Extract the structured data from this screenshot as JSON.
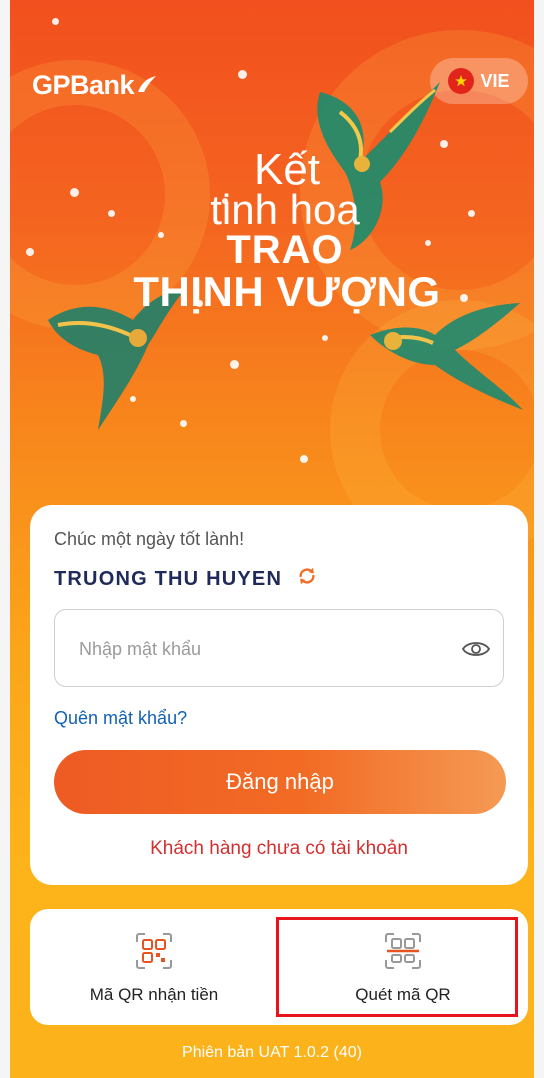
{
  "header": {
    "logo_text": "GPBank",
    "language": {
      "code": "VIE",
      "flag_icon": "vietnam-flag-icon"
    }
  },
  "banner": {
    "line1": "Kết",
    "line2": "tinh hoa",
    "line3": "TRAO",
    "line4": "THỊNH VƯỢNG"
  },
  "login": {
    "greeting": "Chúc một ngày tốt lành!",
    "username": "TRUONG THU HUYEN",
    "password_placeholder": "Nhập mật khẩu",
    "password_value": "",
    "forgot_label": "Quên mật khẩu?",
    "login_label": "Đăng nhập",
    "register_label": "Khách hàng chưa có tài khoản"
  },
  "quick_actions": [
    {
      "label": "Mã QR nhận tiền",
      "icon": "qr-code-icon"
    },
    {
      "label": "Quét mã QR",
      "icon": "qr-scan-icon"
    }
  ],
  "footer": {
    "version": "Phiên bản UAT 1.0.2 (40)"
  },
  "colors": {
    "brand_orange": "#f26b24",
    "link_blue": "#1261b3",
    "register_red": "#d32f2f",
    "name_navy": "#1f2a5a",
    "highlight_red": "#e8141c"
  }
}
